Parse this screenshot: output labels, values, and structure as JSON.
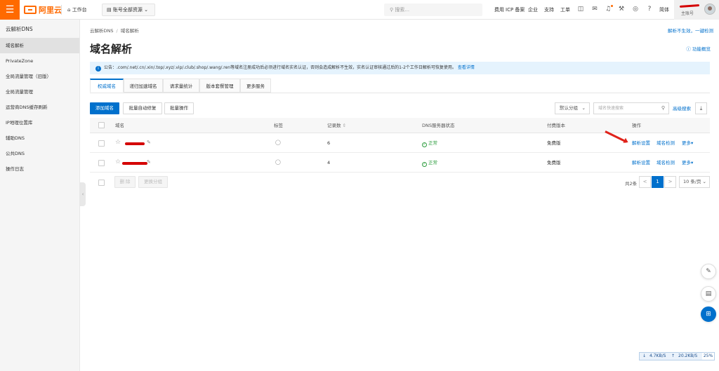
{
  "topbar": {
    "menu_icon": "hamburger-icon",
    "logo_text": "阿里云",
    "workbench": "工作台",
    "account_selector": "账号全部资源",
    "search_placeholder": "搜索...",
    "nav": [
      "费用",
      "ICP 备案",
      "企业",
      "支持",
      "工单"
    ],
    "lang": "简体",
    "user_sub": "主账号"
  },
  "sidebar": {
    "title": "云解析DNS",
    "items": [
      {
        "label": "域名解析",
        "active": true
      },
      {
        "label": "PrivateZone"
      },
      {
        "label": "全局流量管理（旧版）"
      },
      {
        "label": "全局流量管理"
      },
      {
        "label": "运营商DNS缓存刷新"
      },
      {
        "label": "IP地理位置库"
      },
      {
        "label": "辅助DNS"
      },
      {
        "label": "公共DNS"
      },
      {
        "label": "操作日志"
      }
    ]
  },
  "breadcrumb": [
    "云解析DNS",
    "域名解析"
  ],
  "top_link": "解析不生效，一键检测",
  "page_title": "域名解析",
  "help_link": "功能概览",
  "notice": {
    "text": "公告：.com/.net/.cn/.xin/.top/.xyz/.vip/.club/.shop/.wang/.ren等域名注册成功后必须进行域名实名认证，否则会造成解析不生效，实名认证审核通过后的1-2个工作日解析可恢复使用。",
    "link": "查看详情"
  },
  "tabs": [
    "权威域名",
    "递归加速域名",
    "请求量统计",
    "版本套餐管理",
    "更多服务"
  ],
  "toolbar": {
    "add": "添加域名",
    "batch_auto": "批量自动修复",
    "batch_ops": "批量操作",
    "group_select": "默认分组",
    "search_placeholder": "域名快速搜索",
    "advanced": "高级搜索"
  },
  "table": {
    "headers": [
      "域名",
      "标签",
      "记录数",
      "DNS服务器状态",
      "付费版本",
      "操作"
    ],
    "rows": [
      {
        "records": "6",
        "dns_status": "正常",
        "plan": "免费版",
        "actions": [
          "解析设置",
          "域名检测",
          "更多"
        ]
      },
      {
        "records": "4",
        "dns_status": "正常",
        "plan": "免费版",
        "actions": [
          "解析设置",
          "域名检测",
          "更多"
        ]
      }
    ]
  },
  "footer_actions": {
    "delete": "删 除",
    "change_group": "更换分组"
  },
  "pagination": {
    "total": "共2条",
    "prev": "<",
    "current": "1",
    "next": ">",
    "page_size": "10 条/页"
  },
  "netspeed": {
    "up": "4.7KB/S",
    "down": "20.2KB/S",
    "pct": "25%"
  },
  "colors": {
    "brand": "#ff6a00",
    "primary": "#0070cc",
    "success": "#2e9d3f",
    "annotation": "#e0231b"
  }
}
